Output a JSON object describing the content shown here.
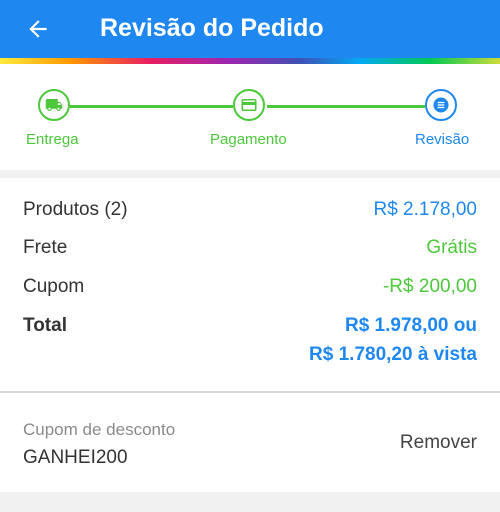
{
  "header": {
    "title": "Revisão do Pedido",
    "back_icon": "arrow-left-icon"
  },
  "colors": {
    "primary": "#1e88f0",
    "success": "#4cc83a",
    "text": "#333333",
    "muted": "#8a8a8a"
  },
  "stepper": {
    "steps": [
      {
        "label": "Entrega",
        "icon": "truck-icon",
        "state": "done"
      },
      {
        "label": "Pagamento",
        "icon": "credit-card-icon",
        "state": "done"
      },
      {
        "label": "Revisão",
        "icon": "list-icon",
        "state": "active"
      }
    ]
  },
  "summary": {
    "products_label": "Produtos (2)",
    "products_value": "R$ 2.178,00",
    "shipping_label": "Frete",
    "shipping_value": "Grátis",
    "coupon_label": "Cupom",
    "coupon_value": "-R$ 200,00",
    "total_label": "Total",
    "total_value_line1": "R$ 1.978,00 ou",
    "total_value_line2": "R$ 1.780,20 à vista"
  },
  "coupon": {
    "label": "Cupom de desconto",
    "code": "GANHEI200",
    "remove_label": "Remover"
  }
}
